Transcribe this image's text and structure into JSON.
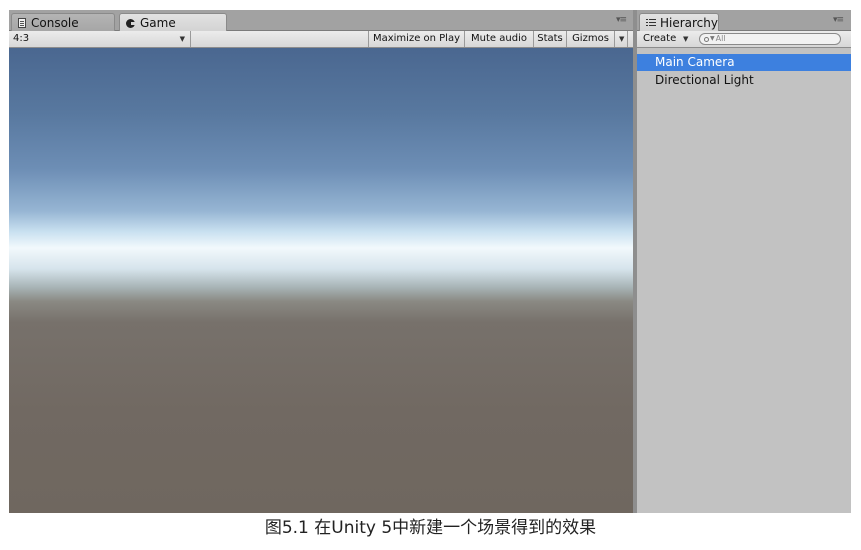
{
  "game_panel": {
    "tabs": [
      {
        "label": "Console",
        "icon": "console-icon",
        "active": false
      },
      {
        "label": "Game",
        "icon": "game-icon",
        "active": true
      }
    ],
    "toolbar": {
      "aspect": "4:3",
      "buttons": [
        "Maximize on Play",
        "Mute audio",
        "Stats",
        "Gizmos"
      ]
    }
  },
  "hierarchy": {
    "tab_label": "Hierarchy",
    "create_label": "Create",
    "search_placeholder": "All",
    "items": [
      {
        "label": "Main Camera",
        "selected": true
      },
      {
        "label": "Directional Light",
        "selected": false
      }
    ]
  },
  "caption": "图5.1 在Unity 5中新建一个场景得到的效果",
  "colors": {
    "selection": "#3d80df",
    "sky_top": "#4a6790",
    "horizon": "#f2f9fc",
    "ground": "#716962"
  }
}
